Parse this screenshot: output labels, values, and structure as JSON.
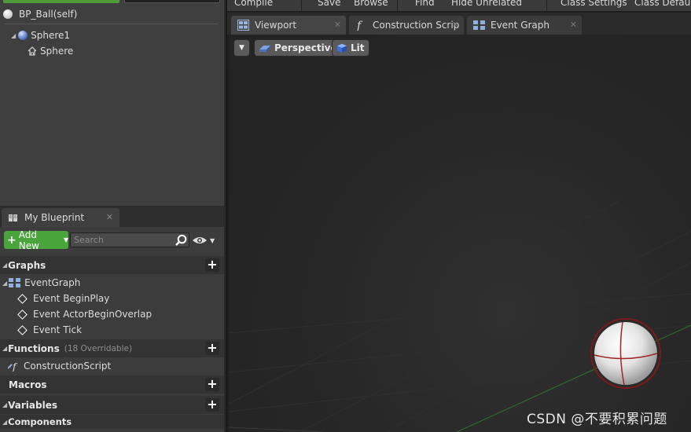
{
  "components": {
    "self_label": "BP_Ball(self)",
    "tree": [
      {
        "label": "Sphere1",
        "icon": "sphere-icon"
      },
      {
        "label": "Sphere",
        "icon": "scene-component-icon"
      }
    ]
  },
  "my_blueprint": {
    "tab_label": "My Blueprint",
    "add_new_label": "Add New",
    "search_placeholder": "Search",
    "sections": {
      "graphs": "Graphs",
      "functions": "Functions",
      "functions_sub": "(18 Overridable)",
      "macros": "Macros",
      "variables": "Variables",
      "components": "Components"
    },
    "graph_items": [
      "EventGraph",
      "Event BeginPlay",
      "Event ActorBeginOverlap",
      "Event Tick"
    ],
    "function_items": [
      "ConstructionScript"
    ]
  },
  "toolbar": {
    "items": [
      "Compile",
      "Save",
      "Browse",
      "Find",
      "Hide Unrelated",
      "Class Settings",
      "Class Defaults"
    ]
  },
  "editor_tabs": [
    {
      "label": "Viewport",
      "icon": "viewport-icon"
    },
    {
      "label": "Construction Scrip",
      "icon": "function-icon"
    },
    {
      "label": "Event Graph",
      "icon": "graph-icon"
    }
  ],
  "viewport": {
    "perspective_label": "Perspective",
    "lit_label": "Lit"
  },
  "watermark": "CSDN @不要积累问题",
  "colors": {
    "accent_green": "#4aa43c",
    "panel_bg": "#3c3c3c",
    "viewport_bg": "#262626"
  }
}
